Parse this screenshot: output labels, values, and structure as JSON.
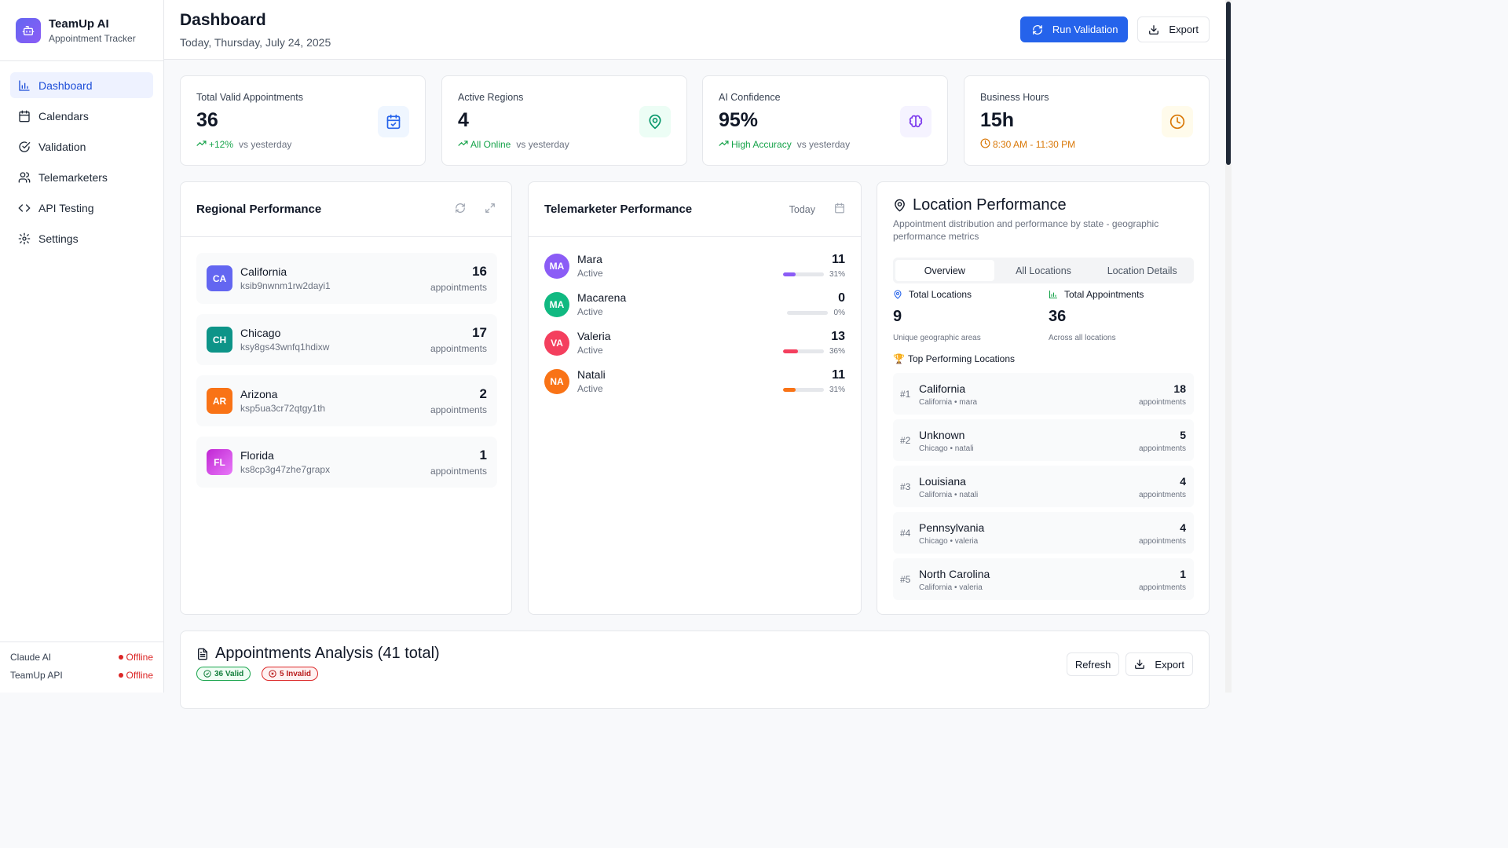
{
  "brand": {
    "title": "TeamUp AI",
    "subtitle": "Appointment Tracker"
  },
  "nav": [
    {
      "label": "Dashboard",
      "icon": "bar-chart-icon",
      "active": true
    },
    {
      "label": "Calendars",
      "icon": "calendar-icon"
    },
    {
      "label": "Validation",
      "icon": "check-circle-icon"
    },
    {
      "label": "Telemarketers",
      "icon": "users-icon"
    },
    {
      "label": "API Testing",
      "icon": "code-icon"
    },
    {
      "label": "Settings",
      "icon": "gear-icon"
    }
  ],
  "services": [
    {
      "name": "Claude AI",
      "status": "Offline"
    },
    {
      "name": "TeamUp API",
      "status": "Offline"
    }
  ],
  "header": {
    "title": "Dashboard",
    "subtitle": "Today, Thursday, July 24, 2025",
    "run_label": "Run Validation",
    "export_label": "Export"
  },
  "stats": [
    {
      "label": "Total Valid Appointments",
      "value": "36",
      "trend": "+12%",
      "vs": "vs yesterday",
      "icon": "calendar-check-icon",
      "color": "#2563eb",
      "bg": "#eff6ff"
    },
    {
      "label": "Active Regions",
      "value": "4",
      "trend": "All Online",
      "vs": "vs yesterday",
      "icon": "map-pin-icon",
      "color": "#059669",
      "bg": "#ecfdf5"
    },
    {
      "label": "AI Confidence",
      "value": "95%",
      "trend": "High Accuracy",
      "vs": "vs yesterday",
      "icon": "brain-icon",
      "color": "#7c3aed",
      "bg": "#f5f3ff"
    },
    {
      "label": "Business Hours",
      "value": "15h",
      "trend": "8:30 AM - 11:30 PM",
      "vs": "",
      "icon": "clock-icon",
      "color": "#d97706",
      "bg": "#fffbeb"
    }
  ],
  "regional": {
    "title": "Regional Performance",
    "items": [
      {
        "abbr": "CA",
        "name": "California",
        "id": "ksib9nwnm1rw2dayi1",
        "count": "16",
        "unit": "appointments",
        "color": "#6366f1"
      },
      {
        "abbr": "CH",
        "name": "Chicago",
        "id": "ksy8gs43wnfq1hdixw",
        "count": "17",
        "unit": "appointments",
        "color": "#0d9488"
      },
      {
        "abbr": "AR",
        "name": "Arizona",
        "id": "ksp5ua3cr72qtgy1th",
        "count": "2",
        "unit": "appointments",
        "color": "#f97316"
      },
      {
        "abbr": "FL",
        "name": "Florida",
        "id": "ks8cp3g47zhe7grapx",
        "count": "1",
        "unit": "appointments",
        "color": "#c026d3"
      }
    ]
  },
  "telemarketers": {
    "title": "Telemarketer Performance",
    "filter": "Today",
    "items": [
      {
        "initials": "MA",
        "name": "Mara",
        "status": "Active",
        "count": "11",
        "pct": "31%",
        "fill": 0.31,
        "color": "#8b5cf6"
      },
      {
        "initials": "MA",
        "name": "Macarena",
        "status": "Active",
        "count": "0",
        "pct": "0%",
        "fill": 0,
        "color": "#10b981"
      },
      {
        "initials": "VA",
        "name": "Valeria",
        "status": "Active",
        "count": "13",
        "pct": "36%",
        "fill": 0.36,
        "color": "#f43f5e"
      },
      {
        "initials": "NA",
        "name": "Natali",
        "status": "Active",
        "count": "11",
        "pct": "31%",
        "fill": 0.31,
        "color": "#f97316"
      }
    ]
  },
  "location": {
    "title": "Location Performance",
    "description": "Appointment distribution and performance by state - geographic performance metrics",
    "tabs": [
      "Overview",
      "All Locations",
      "Location Details"
    ],
    "total_locations": {
      "label": "Total Locations",
      "value": "9",
      "note": "Unique geographic areas"
    },
    "total_appointments": {
      "label": "Total Appointments",
      "value": "36",
      "note": "Across all locations"
    },
    "top_title": "Top Performing Locations",
    "top": [
      {
        "rank": "#1",
        "name": "California",
        "sub": "California • mara",
        "count": "18",
        "unit": "appointments"
      },
      {
        "rank": "#2",
        "name": "Unknown",
        "sub": "Chicago • natali",
        "count": "5",
        "unit": "appointments"
      },
      {
        "rank": "#3",
        "name": "Louisiana",
        "sub": "California • natali",
        "count": "4",
        "unit": "appointments"
      },
      {
        "rank": "#4",
        "name": "Pennsylvania",
        "sub": "Chicago • valeria",
        "count": "4",
        "unit": "appointments"
      },
      {
        "rank": "#5",
        "name": "North Carolina",
        "sub": "California • valeria",
        "count": "1",
        "unit": "appointments"
      }
    ]
  },
  "analysis": {
    "title": "Appointments Analysis (41 total)",
    "valid": "36 Valid",
    "invalid": "5 Invalid",
    "refresh_label": "Refresh",
    "export_label": "Export"
  }
}
